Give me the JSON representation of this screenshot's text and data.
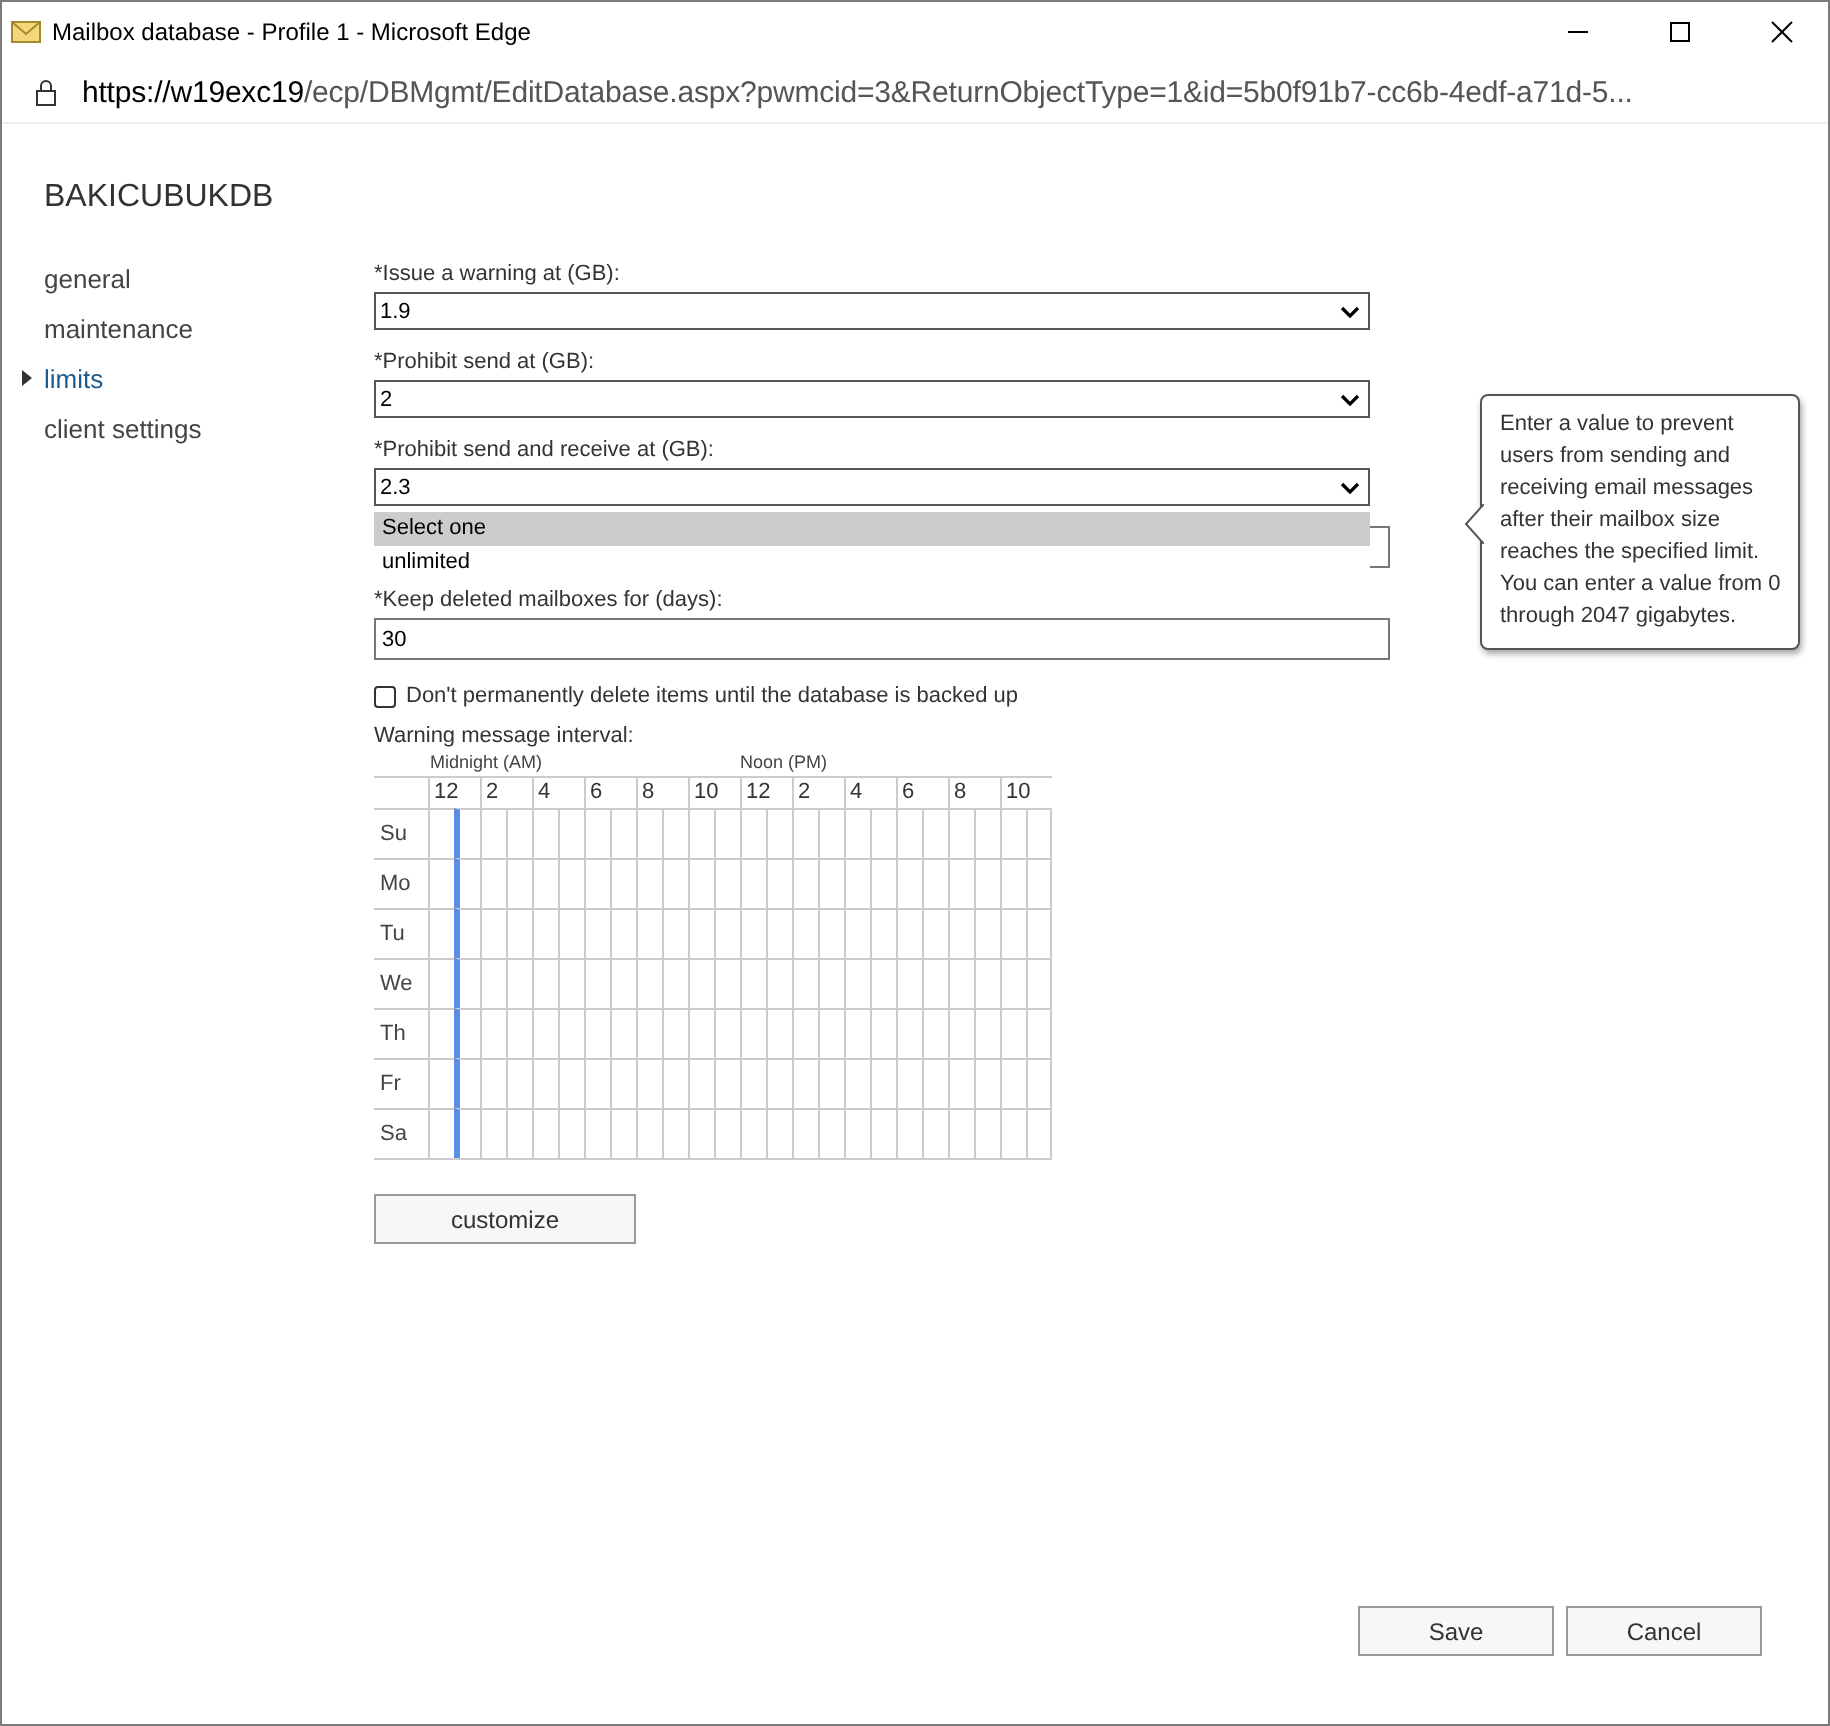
{
  "window": {
    "title": "Mailbox database - Profile 1 - Microsoft Edge"
  },
  "address_bar": {
    "url_host": "https://w19exc19",
    "url_path": "/ecp/DBMgmt/EditDatabase.aspx?pwmcid=3&ReturnObjectType=1&id=5b0f91b7-cc6b-4edf-a71d-5..."
  },
  "page_title": "BAKICUBUKDB",
  "nav": [
    {
      "label": "general",
      "selected": false
    },
    {
      "label": "maintenance",
      "selected": false
    },
    {
      "label": "limits",
      "selected": true
    },
    {
      "label": "client settings",
      "selected": false
    }
  ],
  "fields": [
    {
      "kind": "select",
      "label": "*Issue a warning at (GB):",
      "value": "1.9"
    },
    {
      "kind": "select",
      "label": "*Prohibit send at (GB):",
      "value": "2"
    },
    {
      "kind": "select",
      "label": "*Prohibit send and receive at (GB):",
      "value": "2.3",
      "open": true
    },
    {
      "kind": "text"
    },
    {
      "kind": "text",
      "label": "*Keep deleted mailboxes for (days):",
      "value": "30"
    }
  ],
  "dropdown_options": [
    {
      "label": "Select one",
      "selected": true
    },
    {
      "label": "unlimited",
      "selected": false
    }
  ],
  "checkbox": {
    "label": "Don't permanently delete items until the database is backed up",
    "checked": false
  },
  "schedule": {
    "label": "Warning message interval:",
    "am_label": "Midnight (AM)",
    "pm_label": "Noon (PM)",
    "hours": [
      "12",
      "2",
      "4",
      "6",
      "8",
      "10",
      "12",
      "2",
      "4",
      "6",
      "8",
      "10"
    ],
    "days": [
      "Su",
      "Mo",
      "Tu",
      "We",
      "Th",
      "Fr",
      "Sa"
    ]
  },
  "customize_button": "customize",
  "tooltip": "Enter a value to prevent users from sending and receiving email messages after their mailbox size reaches the specified limit. You can enter a value from 0 through 2047 gigabytes.",
  "buttons": [
    "Save",
    "Cancel"
  ]
}
